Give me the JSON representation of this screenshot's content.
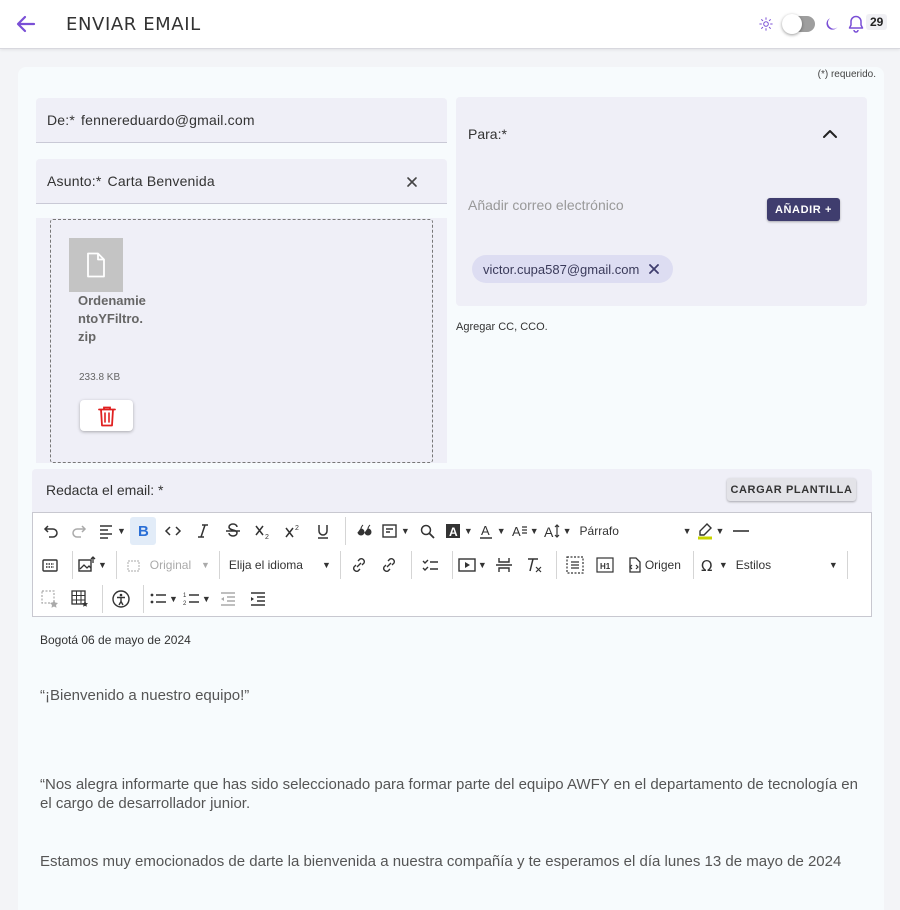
{
  "header": {
    "title": "ENVIAR EMAIL",
    "notification_count": "29"
  },
  "form": {
    "required_note": "(*) requerido.",
    "from_label": "De:*",
    "from_value": "fennereduardo@gmail.com",
    "subject_label": "Asunto:*",
    "subject_value": "Carta Benvenida"
  },
  "attachment": {
    "name": "OrdenamientoYFiltro.zip",
    "size": "233.8 KB"
  },
  "recipients": {
    "to_label": "Para:*",
    "add_placeholder": "Añadir correo electrónico",
    "add_button": "AÑADIR +",
    "chips": [
      "victor.cupa587@gmail.com"
    ],
    "cc_link": "Agregar CC, CCO."
  },
  "compose": {
    "label": "Redacta el email: *",
    "template_button": "CARGAR PLANTILLA"
  },
  "toolbar": {
    "paragraph_select": "Párrafo",
    "image_size_select": "Original",
    "language_select": "Elija el idioma",
    "source_label": "Origen",
    "styles_select": "Estilos"
  },
  "editor": {
    "date_line": "Bogotá 06 de mayo de 2024",
    "greeting": "“¡Bienvenido a nuestro equipo!”",
    "paragraph1": "“Nos alegra informarte  que has sido seleccionado para formar parte del equipo AWFY en el departamento de tecnología en el cargo de desarrollador junior.",
    "paragraph2": "Estamos muy emocionados de darte la bienvenida a nuestra compañía y te esperamos el día lunes 13 de mayo de 2024"
  },
  "colors": {
    "accent": "#7a4fd6",
    "primary_button": "#3f3d6e",
    "delete_red": "#e02020"
  }
}
